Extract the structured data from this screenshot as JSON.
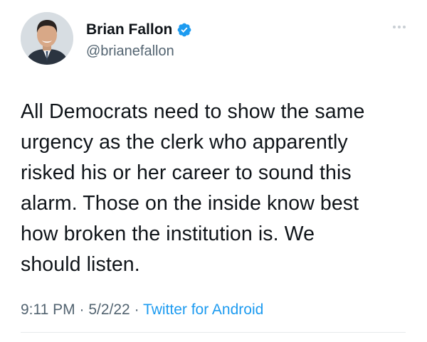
{
  "tweet": {
    "author": {
      "display_name": "Brian Fallon",
      "handle": "@brianefallon",
      "verified": true,
      "avatar_icon": "profile-photo"
    },
    "text": "All Democrats need to show the same\nurgency as the clerk who apparently\nrisked his or her career to sound this\nalarm. Those on the inside know best\nhow broken the institution is. We\nshould listen.",
    "time": "9:11 PM",
    "date": "5/2/22",
    "separator": "·",
    "source": "Twitter for Android"
  },
  "colors": {
    "verified_badge": "#1d9bf0",
    "source_link": "#1d9bf0",
    "secondary_text": "#536471"
  },
  "icons": {
    "more": "more-dots-icon",
    "verified": "verified-badge-icon"
  }
}
